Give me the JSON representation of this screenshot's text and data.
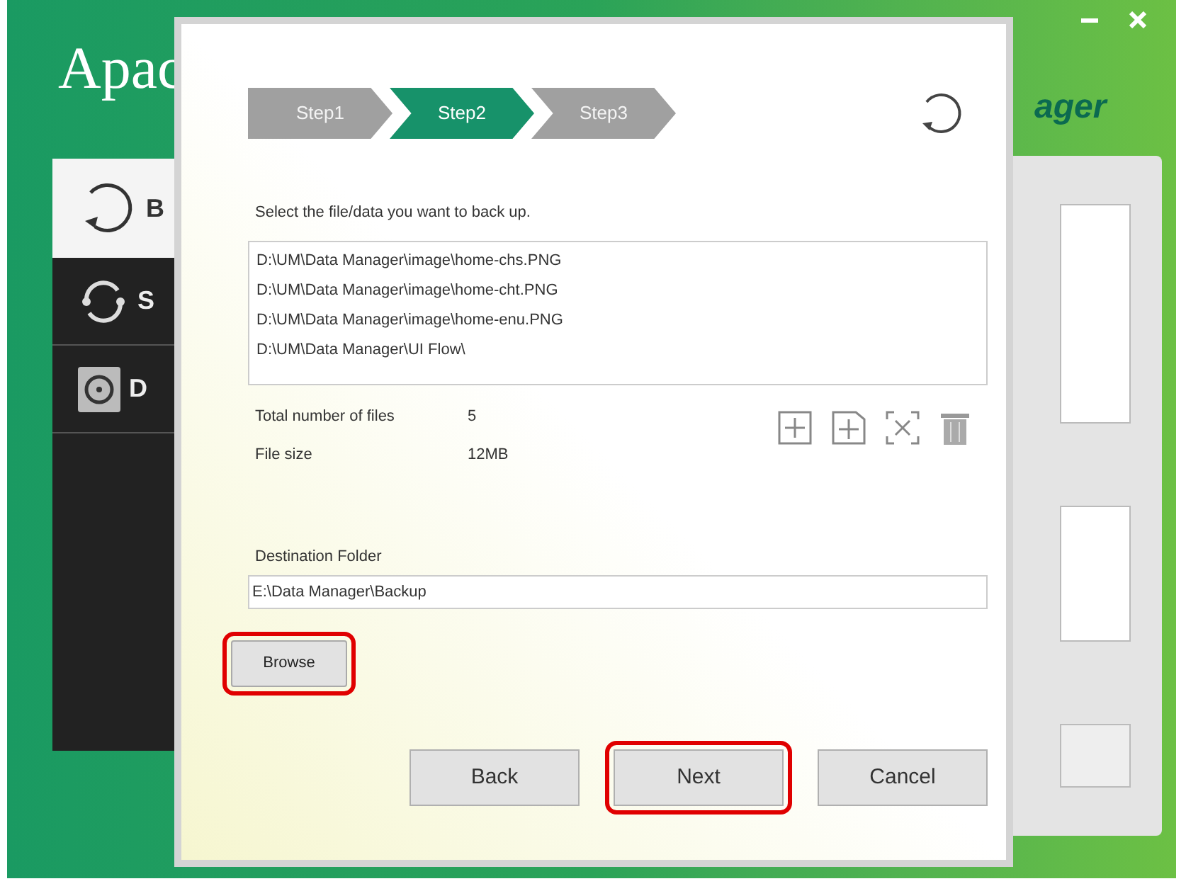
{
  "background_window": {
    "logo": "Apac",
    "subtitle": "ager",
    "sidebar": [
      {
        "label": "B",
        "kind": "backup",
        "selected": true
      },
      {
        "label": "S",
        "kind": "sync",
        "selected": false
      },
      {
        "label": "D",
        "kind": "disk",
        "selected": false
      }
    ]
  },
  "dialog": {
    "steps": [
      {
        "label": "Step1",
        "selected": false
      },
      {
        "label": "Step2",
        "selected": true
      },
      {
        "label": "Step3",
        "selected": false
      }
    ],
    "instruction": "Select the file/data you want to back up.",
    "files": [
      "D:\\UM\\Data Manager\\image\\home-chs.PNG",
      "D:\\UM\\Data Manager\\image\\home-cht.PNG",
      "D:\\UM\\Data Manager\\image\\home-enu.PNG",
      "D:\\UM\\Data Manager\\UI Flow\\"
    ],
    "stats": [
      {
        "label": "Total number of files",
        "value": "5"
      },
      {
        "label": "File size",
        "value": "12MB"
      }
    ],
    "tools": [
      {
        "kind": "add-file"
      },
      {
        "kind": "add-folder"
      },
      {
        "kind": "clear"
      },
      {
        "kind": "delete"
      }
    ],
    "destination_label": "Destination Folder",
    "destination_value": "E:\\Data Manager\\Backup",
    "browse": {
      "label": "Browse",
      "highlighted": true
    },
    "buttons": [
      {
        "label": "Back",
        "highlighted": false
      },
      {
        "label": "Next",
        "highlighted": true
      },
      {
        "label": "Cancel",
        "highlighted": false
      }
    ]
  }
}
